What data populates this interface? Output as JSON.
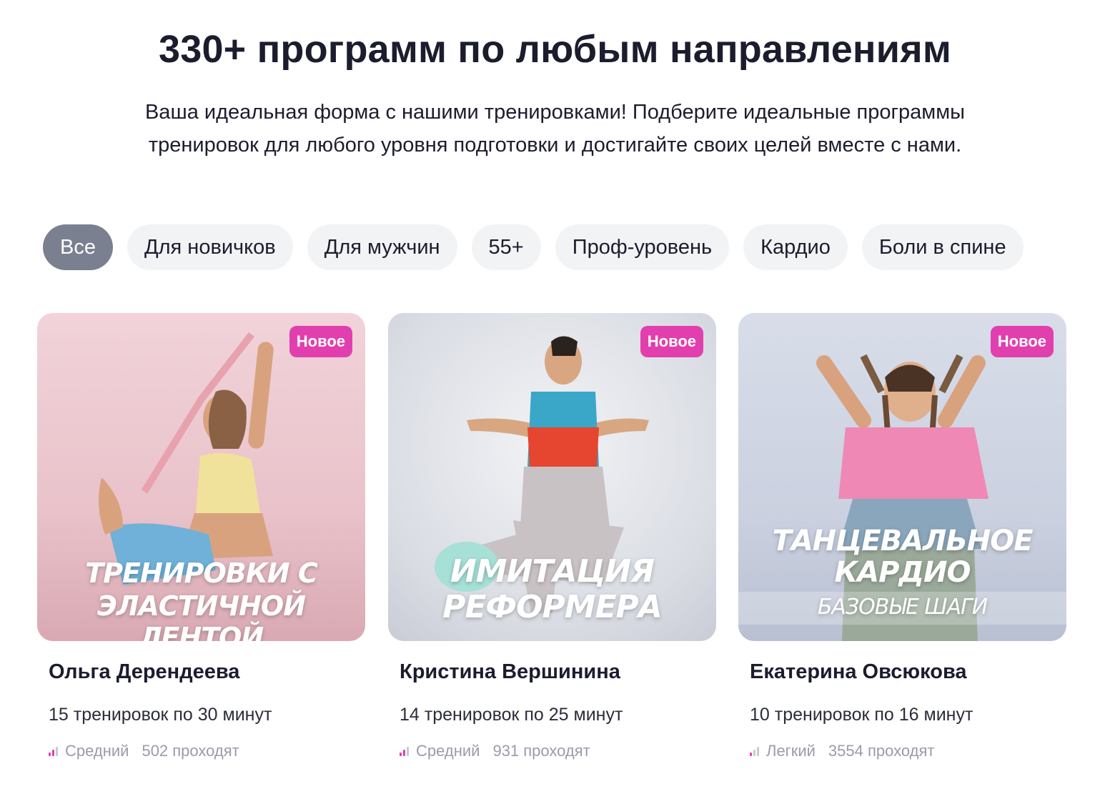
{
  "header": {
    "title": "330+ программ по любым направлениям",
    "subtitle_line1": "Ваша идеальная форма с нашими тренировками! Подберите идеальные программы",
    "subtitle_line2": "тренировок для любого уровня подготовки и достигайте своих целей вместе с нами."
  },
  "filters": [
    {
      "label": "Все",
      "active": true
    },
    {
      "label": "Для новичков",
      "active": false
    },
    {
      "label": "Для мужчин",
      "active": false
    },
    {
      "label": "55+",
      "active": false
    },
    {
      "label": "Проф-уровень",
      "active": false
    },
    {
      "label": "Кардио",
      "active": false
    },
    {
      "label": "Боли в спине",
      "active": false
    }
  ],
  "cards": [
    {
      "badge": "Новое",
      "cover_line1": "Тренировки с",
      "cover_line2": "эластичной лентой",
      "author": "Ольга Дерендеева",
      "workouts": "15 тренировок по 30 минут",
      "level": "Средний",
      "participants": "502 проходят",
      "level_bars": 2
    },
    {
      "badge": "Новое",
      "cover_line1": "Имитация",
      "cover_line2": "реформера",
      "author": "Кристина Вершинина",
      "workouts": "14 тренировок по 25 минут",
      "level": "Средний",
      "participants": "931 проходят",
      "level_bars": 2
    },
    {
      "badge": "Новое",
      "cover_line1": "Танцевальное",
      "cover_line2": "кардио",
      "cover_line3": "Базовые шаги",
      "author": "Екатерина Овсюкова",
      "workouts": "10 тренировок по 16 минут",
      "level": "Легкий",
      "participants": "3554 проходят",
      "level_bars": 1
    }
  ],
  "colors": {
    "accent_badge": "#e23fae",
    "chip_active": "#7b8090",
    "chip_bg": "#f2f3f5",
    "text": "#1b1d2e"
  }
}
